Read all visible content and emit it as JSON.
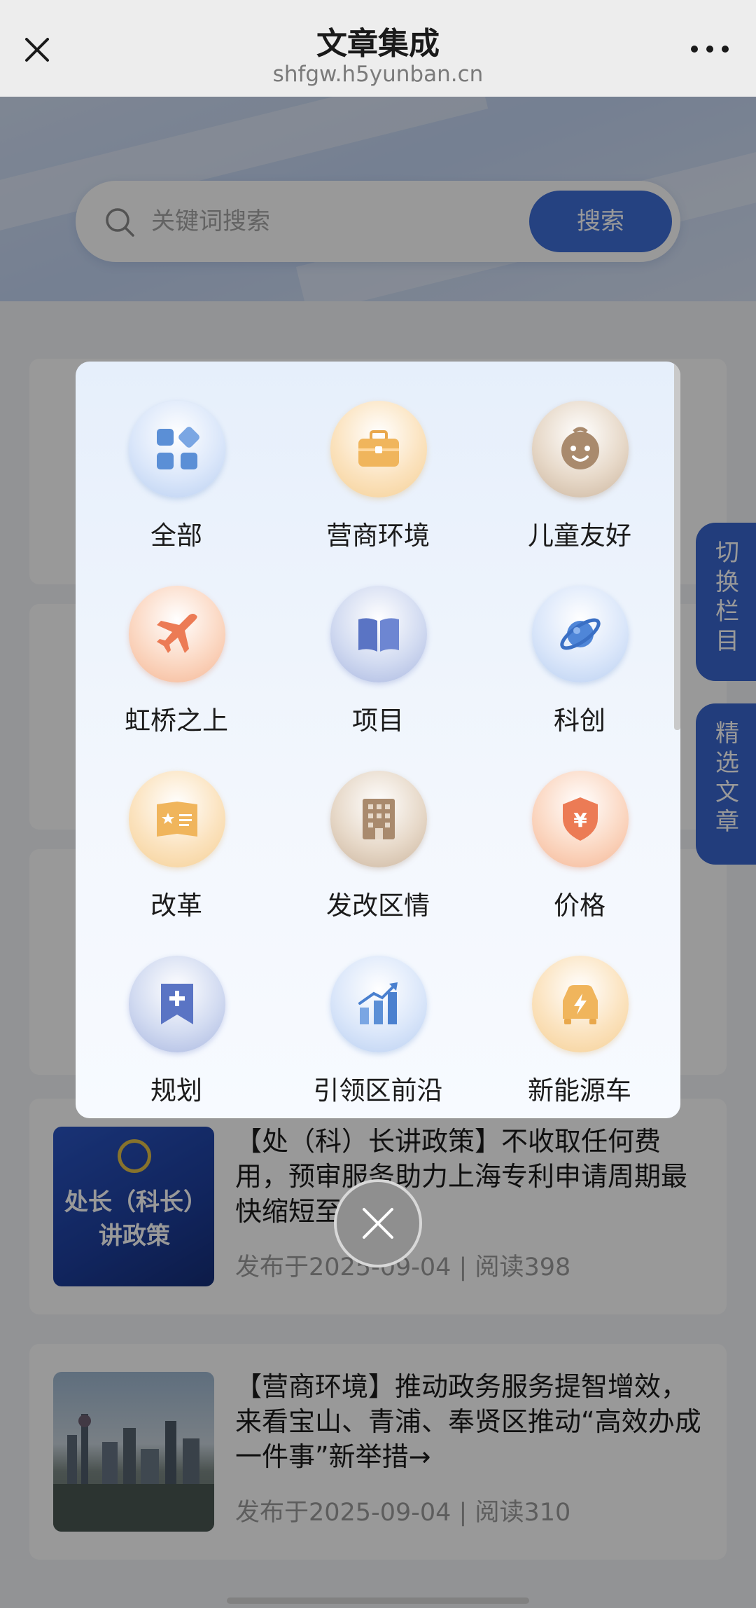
{
  "nav": {
    "title": "文章集成",
    "url": "shfgw.h5yunban.cn",
    "close_icon": "close-icon",
    "more_icon": "more-dots-icon"
  },
  "search": {
    "placeholder": "关键词搜索",
    "button_label": "搜索",
    "icon": "search-icon"
  },
  "side_tabs": {
    "switch_column": [
      "切",
      "换",
      "栏",
      "目"
    ],
    "featured": [
      "精",
      "选",
      "文",
      "章"
    ]
  },
  "articles": [
    {
      "title": "【处（科）长讲政策】不收取任何费用，预审服务助力上海专利申请周期最快缩短至3个月",
      "meta": "发布于2025-09-04 | 阅读398",
      "thumb_text": [
        "处长（科长）",
        "讲政策"
      ]
    },
    {
      "title": "【营商环境】推动政务服务提智增效，来看宝山、青浦、奉贤区推动“高效办成一件事”新举措→",
      "meta": "发布于2025-09-04 | 阅读310"
    }
  ],
  "categories": [
    {
      "label": "全部",
      "icon": "grid-apps-icon",
      "style": "blue"
    },
    {
      "label": "营商环境",
      "icon": "briefcase-icon",
      "style": "orange"
    },
    {
      "label": "儿童友好",
      "icon": "baby-face-icon",
      "style": "brown"
    },
    {
      "label": "虹桥之上",
      "icon": "airplane-icon",
      "style": "red"
    },
    {
      "label": "项目",
      "icon": "open-book-icon",
      "style": "indigo"
    },
    {
      "label": "科创",
      "icon": "planet-icon",
      "style": "blue"
    },
    {
      "label": "改革",
      "icon": "document-star-icon",
      "style": "orange"
    },
    {
      "label": "发改区情",
      "icon": "building-icon",
      "style": "brown"
    },
    {
      "label": "价格",
      "icon": "yuan-shield-icon",
      "style": "red"
    },
    {
      "label": "规划",
      "icon": "bookmark-plus-icon",
      "style": "indigo"
    },
    {
      "label": "引领区前沿",
      "icon": "bar-chart-up-icon",
      "style": "blue"
    },
    {
      "label": "新能源车",
      "icon": "electric-car-icon",
      "style": "orange"
    }
  ],
  "colors": {
    "accent_blue": "#3f6ed8",
    "side_tab_blue": "#3a66cf",
    "overlay": "rgba(0,0,0,0.40)"
  }
}
